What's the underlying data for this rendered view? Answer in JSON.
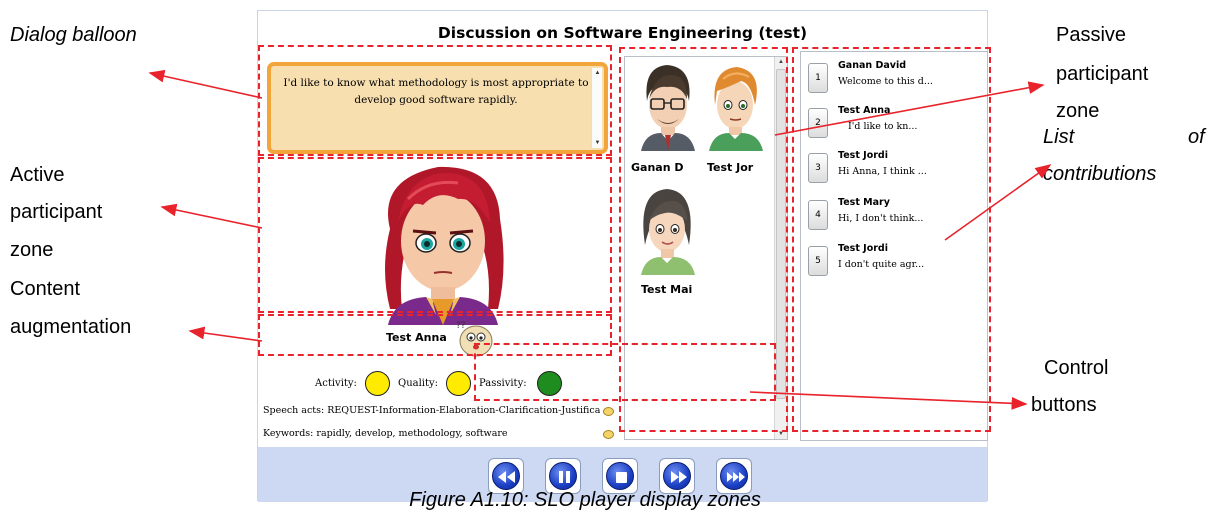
{
  "player": {
    "title": "Discussion on Software Engineering (test)",
    "balloon_text": "I'd like to know what methodology is most appropriate to develop good software rapidly.",
    "active_participant": "Test Anna",
    "augmentation_marks": "??",
    "indicators": {
      "activity_label": "Activity:",
      "quality_label": "Quality:",
      "passivity_label": "Passivity:",
      "activity_color": "#ffeb00",
      "quality_color": "#ffeb00",
      "passivity_color": "#1e8c1e"
    },
    "speech_acts": "Speech acts: REQUEST-Information-Elaboration-Clarification-Justificat",
    "keywords": "Keywords: rapidly, develop, methodology, software",
    "passive_participants": [
      {
        "name": "Ganan D"
      },
      {
        "name": "Test Jor"
      },
      {
        "name": "Test Mai"
      }
    ],
    "contributions": [
      {
        "num": "1",
        "author": "Ganan David",
        "text": "Welcome to this d..."
      },
      {
        "num": "2",
        "author": "Test Anna",
        "text": "I'd like to kn..."
      },
      {
        "num": "3",
        "author": "Test Jordi",
        "text": "Hi Anna, I think ..."
      },
      {
        "num": "4",
        "author": "Test Mary",
        "text": "Hi, I don't think..."
      },
      {
        "num": "5",
        "author": "Test Jordi",
        "text": "I don't quite agr..."
      }
    ],
    "controls": [
      "rewind-icon",
      "pause-icon",
      "stop-icon",
      "fast-forward-icon",
      "skip-forward-icon"
    ]
  },
  "annotations": {
    "dialog_balloon": "Dialog balloon",
    "active_zone": [
      "Active",
      "participant",
      "zone"
    ],
    "content_aug": [
      "Content",
      "augmentation"
    ],
    "passive_zone": [
      "Passive",
      "participant",
      "zone"
    ],
    "list_contrib": [
      "List",
      "of",
      "contributions"
    ],
    "control": [
      "Control",
      "buttons"
    ]
  },
  "caption": "Figure A1.10: SLO player display zones",
  "colors": {
    "annotation_red": "#e8232b",
    "balloon_fill": "#f7dfaf",
    "balloon_border": "#f2a53a",
    "control_bar": "#cdd9f2",
    "button_blue": "#1b3fc4"
  }
}
